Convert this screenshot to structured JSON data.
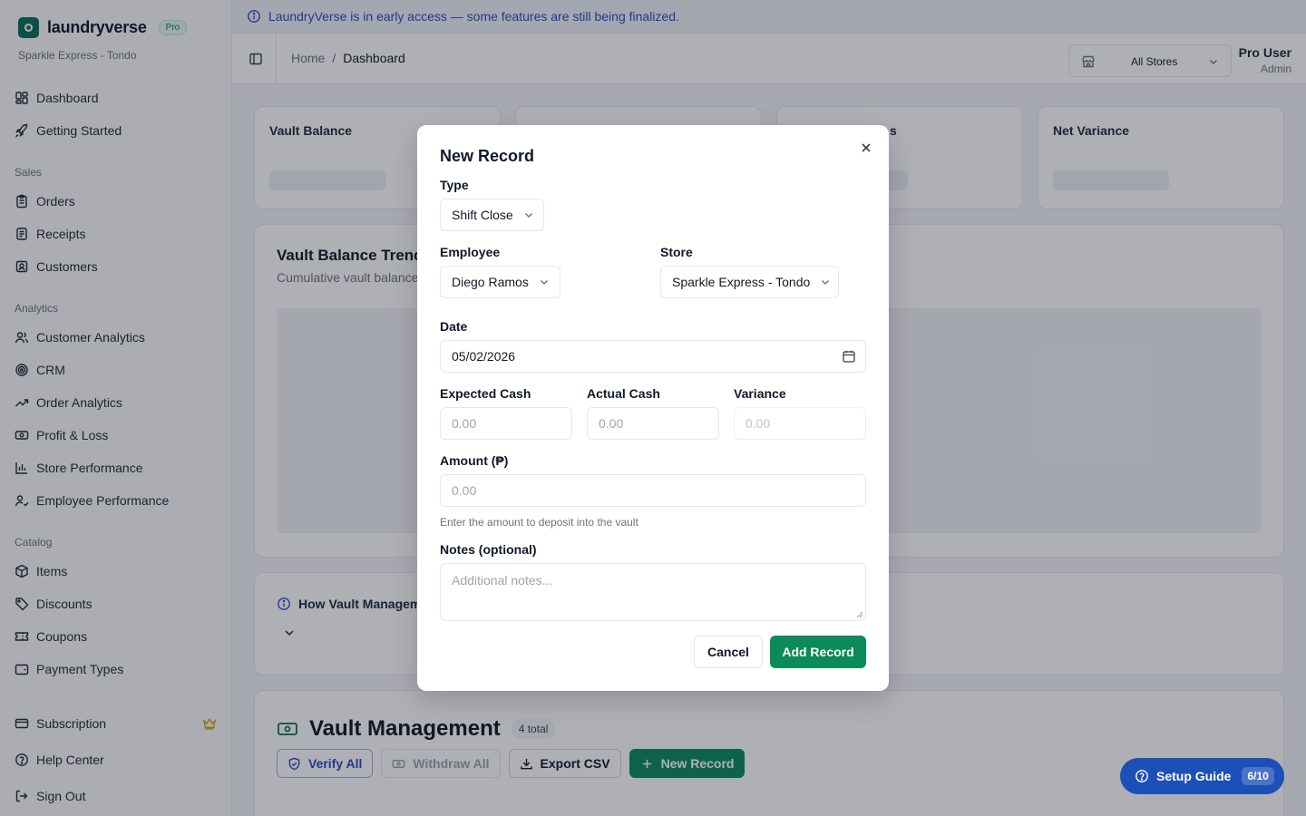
{
  "banner": {
    "text": "LaundryVerse is in early access — some features are still being finalized."
  },
  "brand": {
    "name": "laundryverse",
    "badge": "Pro",
    "store": "Sparkle Express - Tondo"
  },
  "sidebar": {
    "top_items": [
      {
        "label": "Dashboard",
        "icon": "dashboard-icon"
      },
      {
        "label": "Getting Started",
        "icon": "rocket-icon"
      }
    ],
    "sections": [
      {
        "title": "Sales",
        "items": [
          {
            "label": "Orders",
            "icon": "clipboard-icon"
          },
          {
            "label": "Receipts",
            "icon": "receipt-icon"
          },
          {
            "label": "Customers",
            "icon": "contact-icon"
          }
        ]
      },
      {
        "title": "Analytics",
        "items": [
          {
            "label": "Customer Analytics",
            "icon": "users-icon"
          },
          {
            "label": "CRM",
            "icon": "target-icon"
          },
          {
            "label": "Order Analytics",
            "icon": "trending-up-icon"
          },
          {
            "label": "Profit & Loss",
            "icon": "banknote-icon"
          },
          {
            "label": "Store Performance",
            "icon": "bar-chart-icon"
          },
          {
            "label": "Employee Performance",
            "icon": "user-check-icon"
          }
        ]
      },
      {
        "title": "Catalog",
        "items": [
          {
            "label": "Items",
            "icon": "package-icon"
          },
          {
            "label": "Discounts",
            "icon": "tag-icon"
          },
          {
            "label": "Coupons",
            "icon": "ticket-icon"
          },
          {
            "label": "Payment Types",
            "icon": "wallet-icon"
          }
        ]
      }
    ],
    "bottom_items": [
      {
        "label": "Subscription",
        "icon": "credit-card-icon"
      },
      {
        "label": "Help Center",
        "icon": "help-circle-icon"
      },
      {
        "label": "Sign Out",
        "icon": "log-out-icon"
      }
    ]
  },
  "topbar": {
    "breadcrumb": {
      "home": "Home",
      "separator": "/",
      "current": "Dashboard"
    },
    "store_selector": "All Stores",
    "user": {
      "name": "Pro User",
      "role": "Admin"
    }
  },
  "stats": [
    {
      "label": "Vault Balance"
    },
    {
      "label": ""
    },
    {
      "label": "s"
    },
    {
      "label": "Net Variance"
    }
  ],
  "trend": {
    "title": "Vault Balance Trend",
    "subtitle": "Cumulative vault balance"
  },
  "how": {
    "title": "How Vault Managem"
  },
  "vault": {
    "title": "Vault Management",
    "count": "4 total",
    "actions": {
      "verify": "Verify All",
      "withdraw": "Withdraw All",
      "export": "Export CSV",
      "new": "New Record"
    }
  },
  "setup_guide": {
    "label": "Setup Guide",
    "progress": "6/10"
  },
  "modal": {
    "title": "New Record",
    "type": {
      "label": "Type",
      "value": "Shift Close"
    },
    "employee": {
      "label": "Employee",
      "value": "Diego Ramos"
    },
    "store": {
      "label": "Store",
      "value": "Sparkle Express - Tondo"
    },
    "date": {
      "label": "Date",
      "value": "05/02/2026"
    },
    "expected_cash": {
      "label": "Expected Cash",
      "placeholder": "0.00"
    },
    "actual_cash": {
      "label": "Actual Cash",
      "placeholder": "0.00"
    },
    "variance": {
      "label": "Variance",
      "placeholder": "0.00"
    },
    "amount": {
      "label": "Amount (₱)",
      "placeholder": "0.00",
      "hint": "Enter the amount to deposit into the vault"
    },
    "notes": {
      "label": "Notes (optional)",
      "placeholder": "Additional notes..."
    },
    "cancel": "Cancel",
    "submit": "Add Record"
  }
}
